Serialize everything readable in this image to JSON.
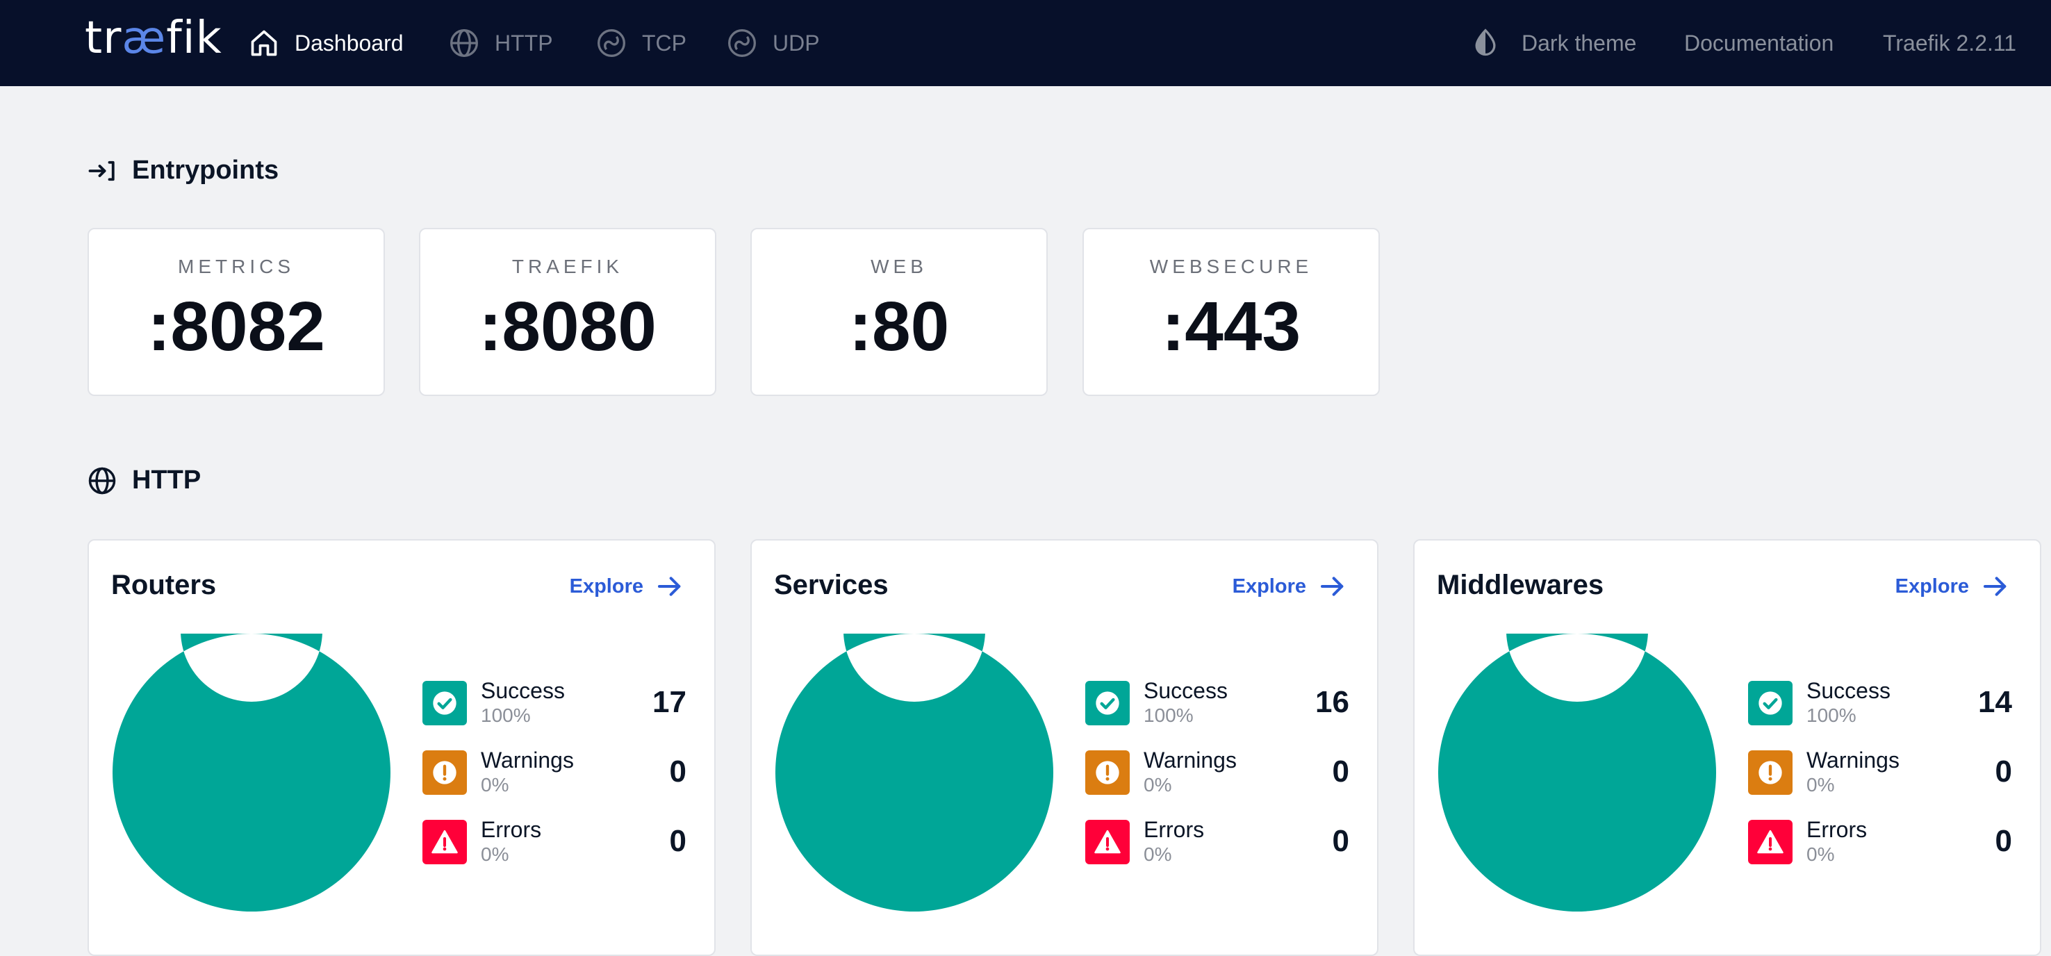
{
  "brand": {
    "logo_pre": "tr",
    "logo_ae": "æ",
    "logo_post": "fik"
  },
  "nav": {
    "dashboard": "Dashboard",
    "http": "HTTP",
    "tcp": "TCP",
    "udp": "UDP",
    "dark_theme": "Dark theme",
    "documentation": "Documentation",
    "version": "Traefik 2.2.11"
  },
  "entrypoints": {
    "title": "Entrypoints",
    "items": [
      {
        "name": "METRICS",
        "port": ":8082"
      },
      {
        "name": "TRAEFIK",
        "port": ":8080"
      },
      {
        "name": "WEB",
        "port": ":80"
      },
      {
        "name": "WEBSECURE",
        "port": ":443"
      }
    ]
  },
  "http": {
    "title": "HTTP",
    "explore_label": "Explore",
    "panels": [
      {
        "title": "Routers",
        "success": {
          "label": "Success",
          "pct": "100%",
          "count": "17"
        },
        "warnings": {
          "label": "Warnings",
          "pct": "0%",
          "count": "0"
        },
        "errors": {
          "label": "Errors",
          "pct": "0%",
          "count": "0"
        }
      },
      {
        "title": "Services",
        "success": {
          "label": "Success",
          "pct": "100%",
          "count": "16"
        },
        "warnings": {
          "label": "Warnings",
          "pct": "0%",
          "count": "0"
        },
        "errors": {
          "label": "Errors",
          "pct": "0%",
          "count": "0"
        }
      },
      {
        "title": "Middlewares",
        "success": {
          "label": "Success",
          "pct": "100%",
          "count": "14"
        },
        "warnings": {
          "label": "Warnings",
          "pct": "0%",
          "count": "0"
        },
        "errors": {
          "label": "Errors",
          "pct": "0%",
          "count": "0"
        }
      }
    ]
  },
  "colors": {
    "success": "#00a697",
    "warning": "#db7d11",
    "error": "#ff0039",
    "accent": "#2b5bd7",
    "navbar": "#07102a"
  },
  "chart_data": [
    {
      "type": "pie",
      "categories": [
        "Success",
        "Warnings",
        "Errors"
      ],
      "values": [
        17,
        0,
        0
      ]
    },
    {
      "type": "pie",
      "categories": [
        "Success",
        "Warnings",
        "Errors"
      ],
      "values": [
        16,
        0,
        0
      ]
    },
    {
      "type": "pie",
      "categories": [
        "Success",
        "Warnings",
        "Errors"
      ],
      "values": [
        14,
        0,
        0
      ]
    }
  ]
}
